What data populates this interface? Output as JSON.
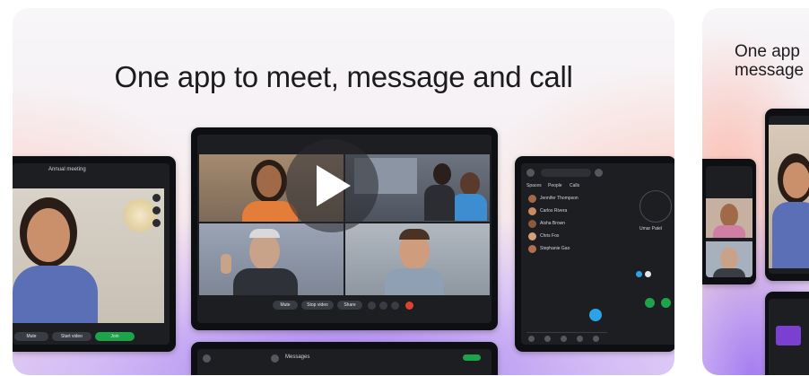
{
  "main_card": {
    "headline": "One app to meet, message and call",
    "left_device": {
      "title": "Annual meeting",
      "controls": [
        "Mute",
        "Start video",
        "Join"
      ]
    },
    "center_device": {
      "controls": [
        "Mute",
        "Stop video",
        "Share"
      ]
    },
    "right_device": {
      "tabs": [
        "Spaces",
        "People",
        "Calls"
      ],
      "contacts": [
        "Jennifer Thompson",
        "Carlos Rivera",
        "Aisha Brown",
        "Chris Fox",
        "Stephanie Gao"
      ],
      "call_name": "Umar Patel"
    },
    "bottom_device": {
      "title": "Messages"
    }
  },
  "peek_card": {
    "title": "One app\nmessage"
  },
  "icons": {
    "play": "play-icon"
  },
  "colors": {
    "join_green": "#1fa34a",
    "end_red": "#e0402f",
    "accent_blue": "#2ba3e6"
  }
}
